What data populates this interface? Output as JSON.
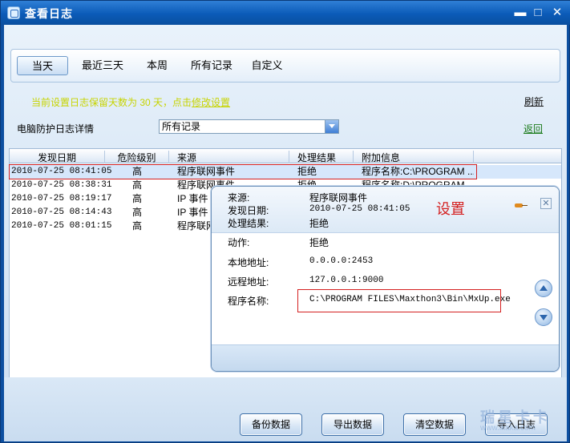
{
  "window": {
    "title": "查看日志",
    "minimize": "▬",
    "maximize": "□",
    "close": "✕"
  },
  "tabs": [
    "当天",
    "最近三天",
    "本周",
    "所有记录",
    "自定义"
  ],
  "notice": {
    "text": "当前设置日志保留天数为 30 天，点击",
    "link": "修改设置"
  },
  "refresh": "刷新",
  "detail_label": "电脑防护日志详情",
  "filter": {
    "selected": "所有记录"
  },
  "back": "返回",
  "columns": [
    "发现日期",
    "危险级别",
    "来源",
    "处理结果",
    "附加信息"
  ],
  "rows": [
    {
      "date": "2010-07-25 08:41:05",
      "level": "高",
      "source": "程序联网事件",
      "result": "拒绝",
      "info": "程序名称:C:\\PROGRAM ..."
    },
    {
      "date": "2010-07-25 08:38:31",
      "level": "高",
      "source": "程序联网事件",
      "result": "拒绝",
      "info": "程序名称:D:\\PROGRAM ..."
    },
    {
      "date": "2010-07-25 08:19:17",
      "level": "高",
      "source": "IP 事件",
      "result": "",
      "info": ""
    },
    {
      "date": "2010-07-25 08:14:43",
      "level": "高",
      "source": "IP 事件",
      "result": "",
      "info": ""
    },
    {
      "date": "2010-07-25 08:01:15",
      "level": "高",
      "source": "程序联网",
      "result": "",
      "info": ""
    }
  ],
  "popup": {
    "source_label": "来源:",
    "source": "程序联网事件",
    "date_label": "发现日期:",
    "date": "2010-07-25 08:41:05",
    "result_label": "处理结果:",
    "result": "拒绝",
    "settings": "设置",
    "action_label": "动作:",
    "action": "拒绝",
    "local_label": "本地地址:",
    "local": "0.0.0.0:2453",
    "remote_label": "远程地址:",
    "remote": "127.0.0.1:9000",
    "program_label": "程序名称:",
    "program": "C:\\PROGRAM FILES\\Maxthon3\\Bin\\MxUp.exe"
  },
  "buttons": {
    "backup": "备份数据",
    "export": "导出数据",
    "clear": "清空数据",
    "import": "导入日志"
  },
  "watermark": {
    "line1": "瑞星卡卡",
    "line2": "www.ikaka.com"
  }
}
